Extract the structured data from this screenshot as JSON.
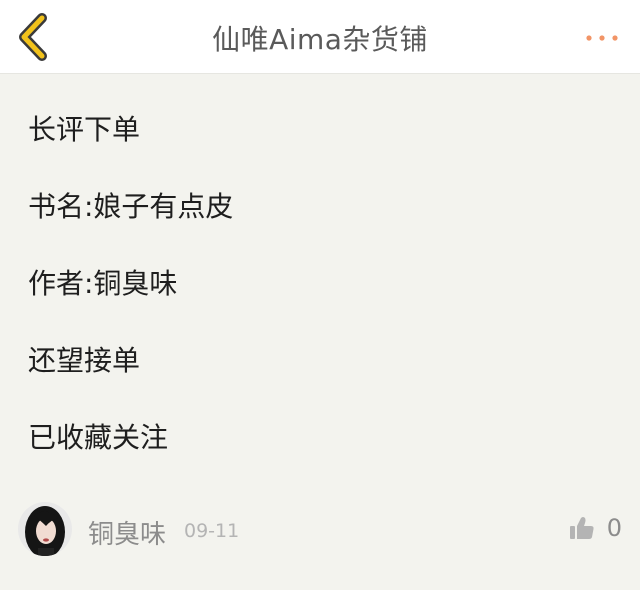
{
  "header": {
    "title": "仙唯Aima杂货铺",
    "back_icon": "chevron-left-icon",
    "more_icon": "more-dots-icon"
  },
  "post": {
    "lines": [
      "长评下单",
      "书名:娘子有点皮",
      "作者:铜臭味",
      "还望接单",
      "已收藏关注"
    ]
  },
  "footer": {
    "author": "铜臭味",
    "date": "09-11",
    "like_icon": "thumbs-up-icon",
    "like_count": "0"
  },
  "colors": {
    "accent_yellow": "#f2c21b",
    "more_orange": "#f29466"
  }
}
